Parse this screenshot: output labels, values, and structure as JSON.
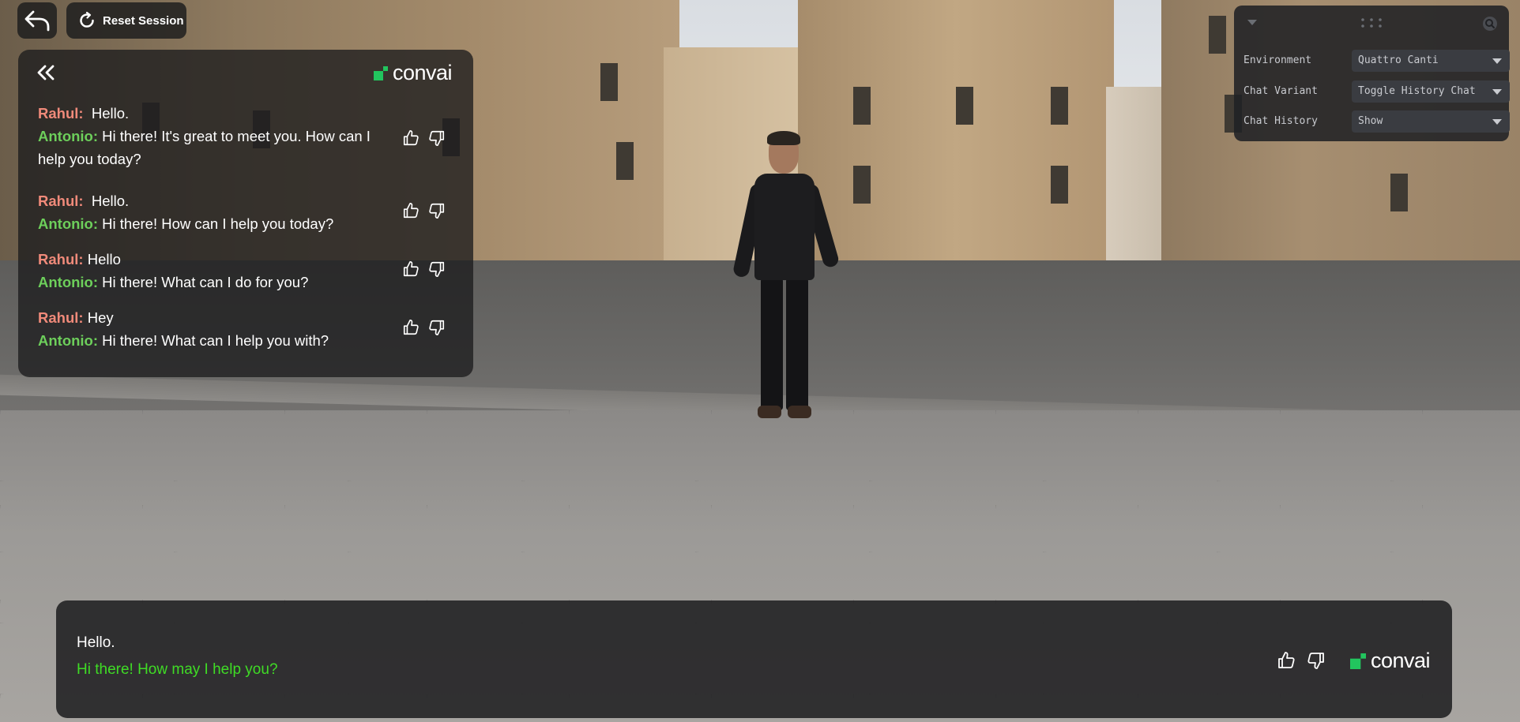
{
  "controls": {
    "back_icon": "undo-arrow-icon",
    "reset_label": "Reset Session"
  },
  "history": {
    "collapse_icon": "double-chevron-left-icon",
    "brand": "convai",
    "messages": [
      {
        "user": "Rahul:",
        "user_text": "Hello.",
        "npc": "Antonio:",
        "npc_text": "Hi there! It's great to meet you. How can I help you today?"
      },
      {
        "user": "Rahul:",
        "user_text": "Hello.",
        "npc": "Antonio:",
        "npc_text": "Hi there! How can I help you today?"
      },
      {
        "user": "Rahul:",
        "user_text": "Hello",
        "npc": "Antonio:",
        "npc_text": "Hi there! What can I do for you?"
      },
      {
        "user": "Rahul:",
        "user_text": "Hey",
        "npc": "Antonio:",
        "npc_text": "Hi there! What can I help you with?"
      }
    ]
  },
  "settings": {
    "rows": [
      {
        "label": "Environment",
        "value": "Quattro Canti"
      },
      {
        "label": "Chat Variant",
        "value": "Toggle History Chat"
      },
      {
        "label": "Chat History",
        "value": "Show"
      }
    ]
  },
  "subtitle": {
    "user_line": "Hello.",
    "npc_line": "Hi there! How may I help you?",
    "brand": "convai"
  },
  "colors": {
    "user_name": "#f08a7a",
    "npc_name": "#6dcf5b",
    "npc_subtitle": "#3fdc25",
    "brand_green": "#22c55e"
  }
}
